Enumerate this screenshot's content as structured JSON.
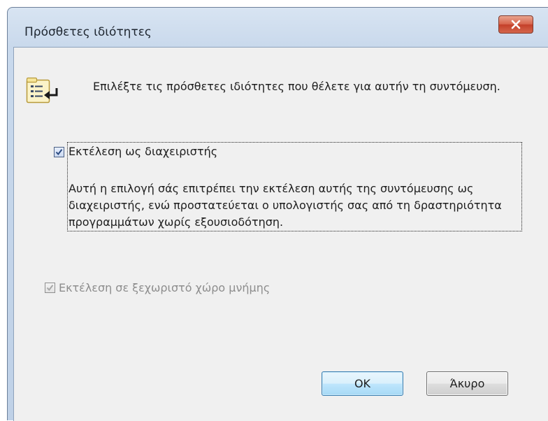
{
  "dialog": {
    "title": "Πρόσθετες ιδιότητες",
    "instruction": "Επιλέξτε τις πρόσθετες ιδιότητες που θέλετε για αυτήν τη συντόμευση.",
    "header_icon": "shortcut-properties-icon",
    "close_icon": "close-icon",
    "accent_close_color": "#c4402a"
  },
  "options": {
    "run_as_admin": {
      "label": "Εκτέλεση ως διαχειριστής",
      "checked": true,
      "enabled": true,
      "description": "Αυτή η επιλογή σάς επιτρέπει την εκτέλεση αυτής της συντόμευσης ως διαχειριστής, ενώ προστατεύεται ο υπολογιστής σας από τη δραστηριότητα προγραμμάτων χωρίς εξουσιοδότηση."
    },
    "separate_memory": {
      "label": "Εκτέλεση σε ξεχωριστό χώρο μνήμης",
      "checked": true,
      "enabled": false
    }
  },
  "buttons": {
    "ok": "OK",
    "cancel": "Άκυρο"
  }
}
